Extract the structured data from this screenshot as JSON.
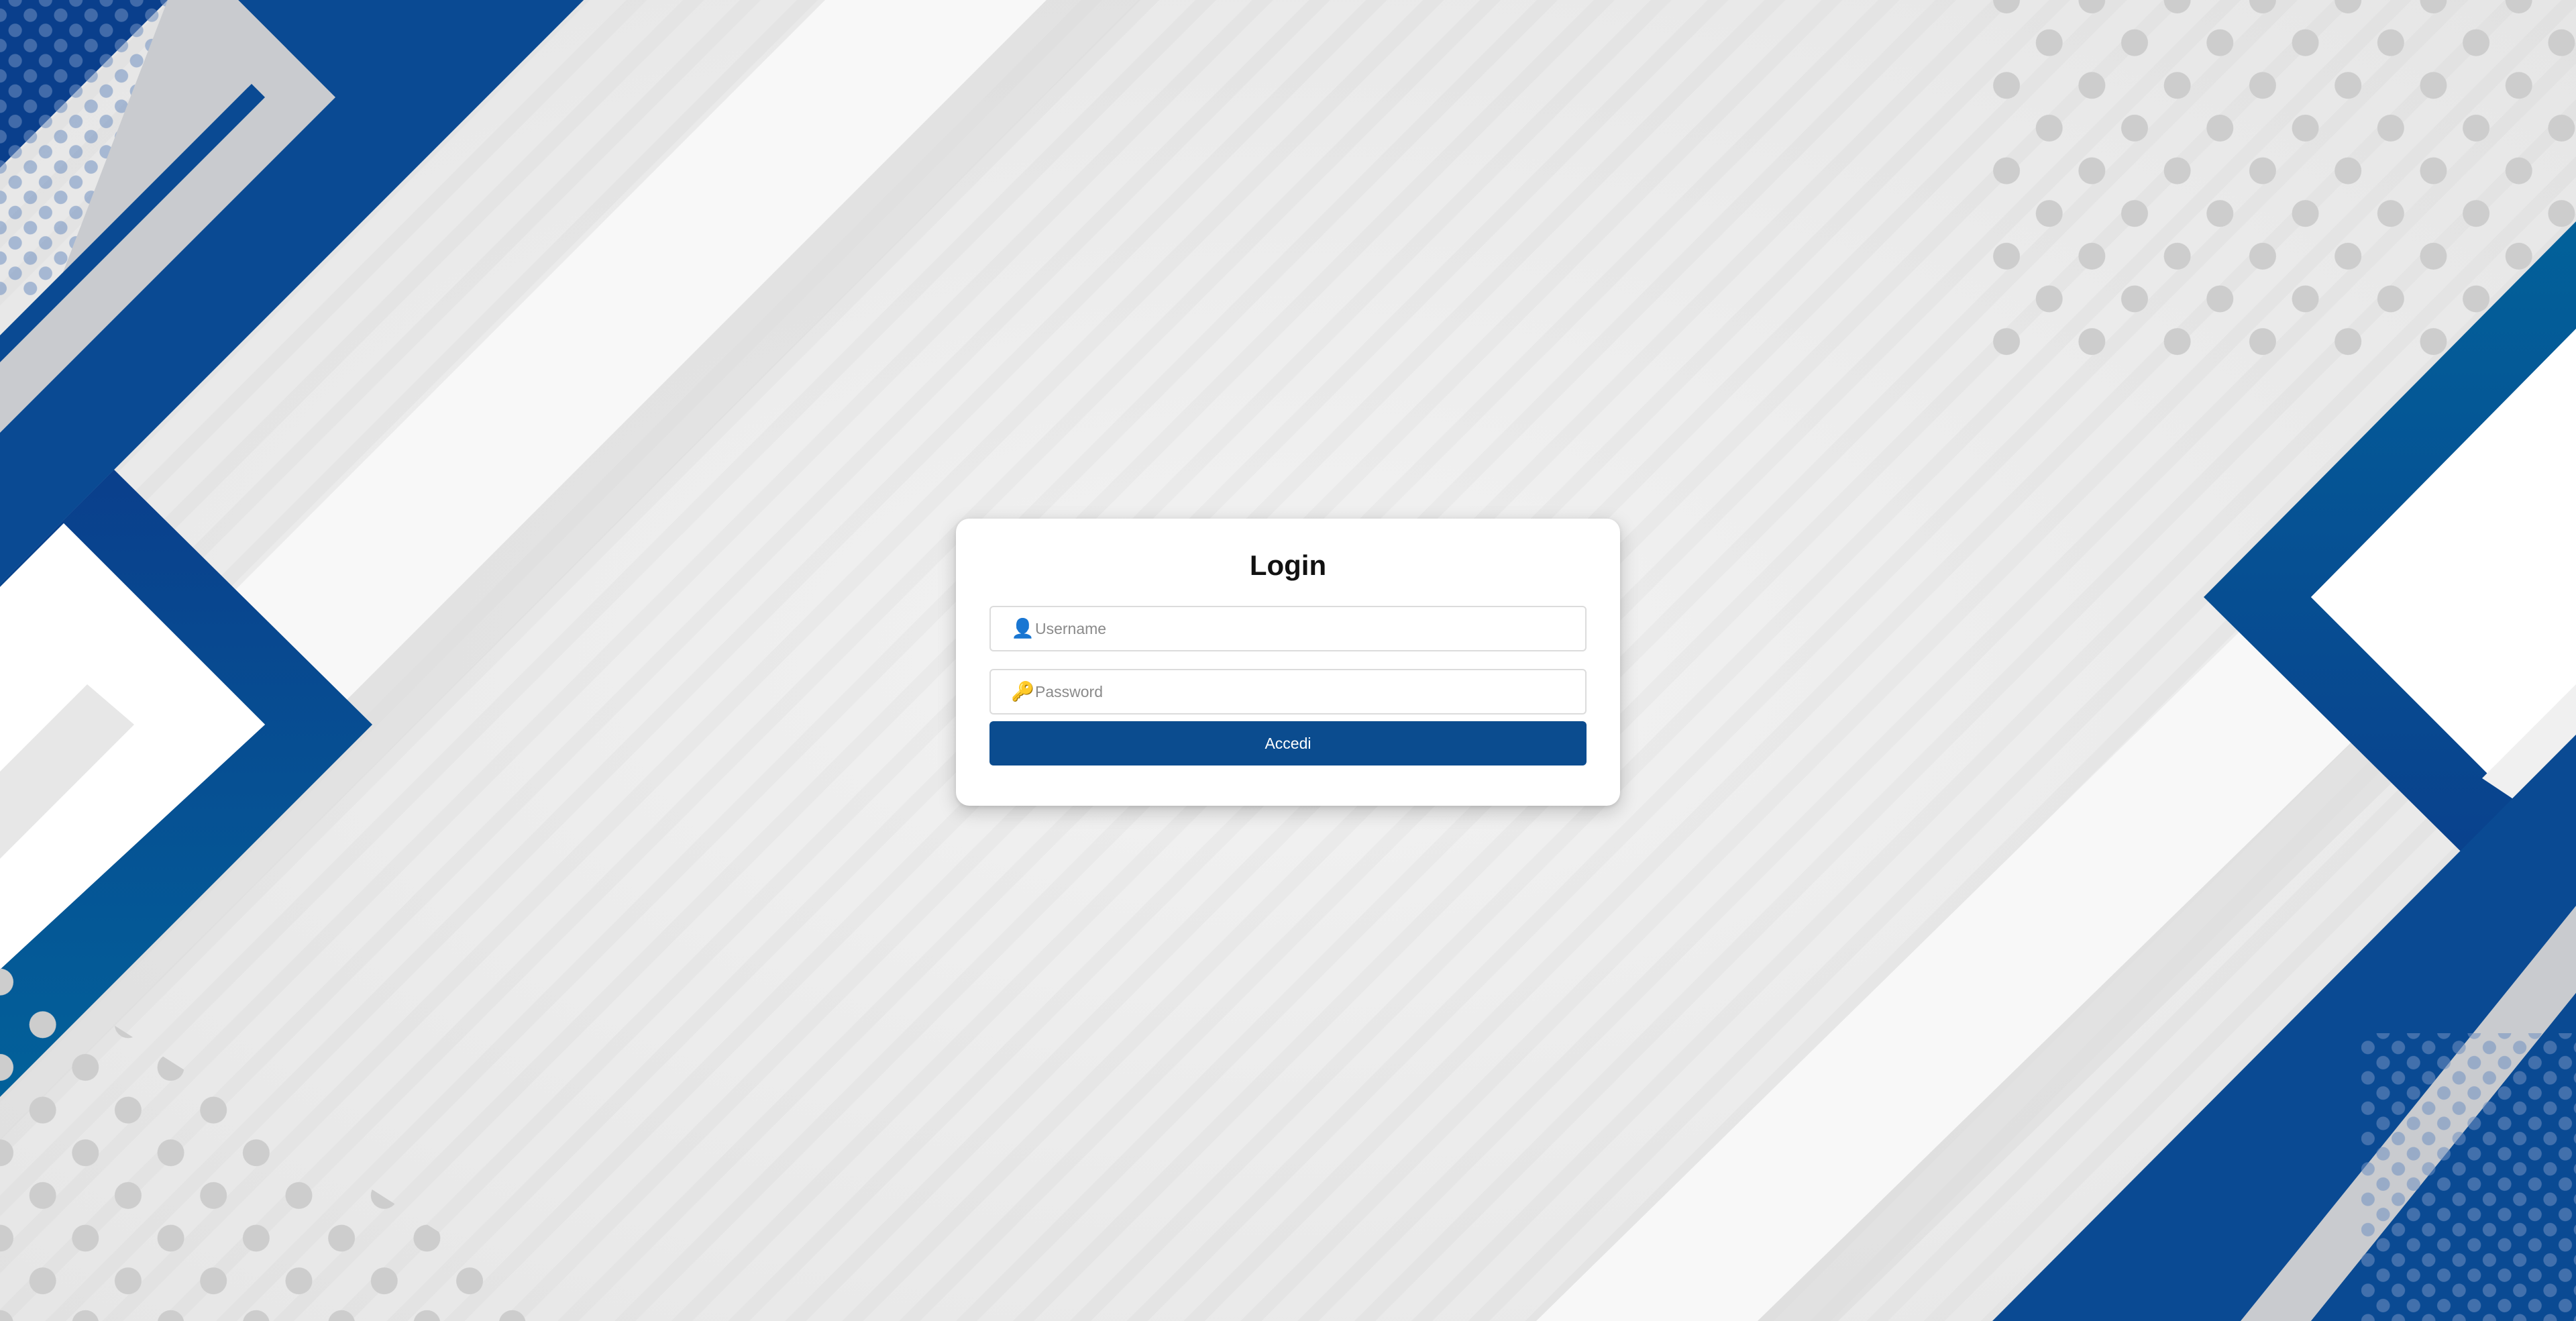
{
  "login": {
    "title": "Login",
    "username_placeholder": "Username",
    "username_icon": "user-icon",
    "password_placeholder": "Password",
    "password_icon": "key-icon",
    "submit_label": "Accedi"
  },
  "colors": {
    "primary_blue": "#0b4c8f",
    "dark_blue": "#0a3f8c",
    "teal_blue": "#02619a",
    "background_gray": "#efefef",
    "dot_gray": "#cdcdcd",
    "card_background": "#ffffff"
  }
}
